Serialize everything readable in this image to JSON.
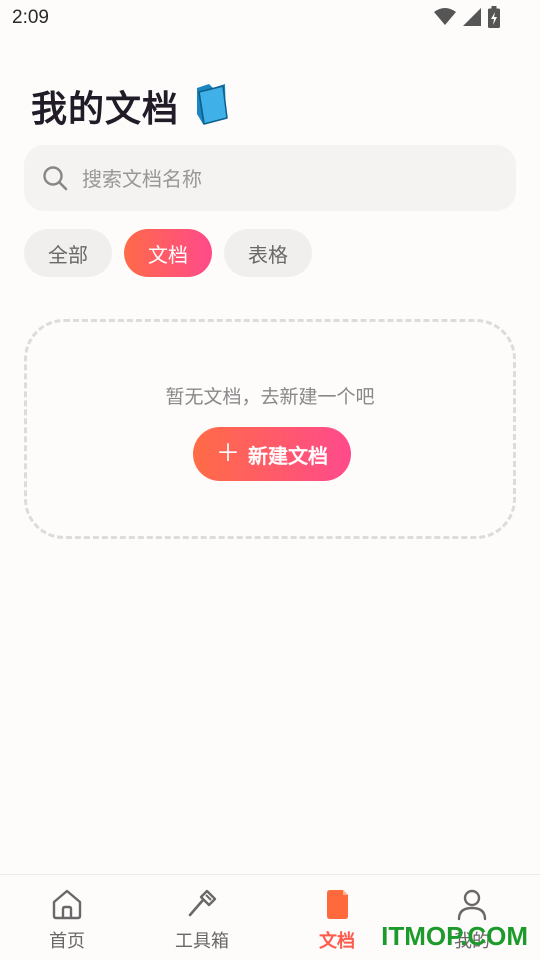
{
  "status_bar": {
    "time": "2:09"
  },
  "header": {
    "title": "我的文档",
    "title_icon": "folder-icon"
  },
  "search": {
    "placeholder": "搜索文档名称",
    "value": ""
  },
  "filters": [
    {
      "label": "全部",
      "active": false
    },
    {
      "label": "文档",
      "active": true
    },
    {
      "label": "表格",
      "active": false
    }
  ],
  "empty_state": {
    "message": "暂无文档，去新建一个吧",
    "button_label": "新建文档"
  },
  "bottom_nav": [
    {
      "label": "首页",
      "icon": "home-icon",
      "active": false
    },
    {
      "label": "工具箱",
      "icon": "tools-icon",
      "active": false
    },
    {
      "label": "文档",
      "icon": "document-icon",
      "active": true
    },
    {
      "label": "我的",
      "icon": "user-icon",
      "active": false
    }
  ],
  "watermark": "ITMOP.COM",
  "colors": {
    "accent_start": "#ff6a49",
    "accent_end": "#ff4a8a",
    "active_nav": "#ff5a4e"
  }
}
